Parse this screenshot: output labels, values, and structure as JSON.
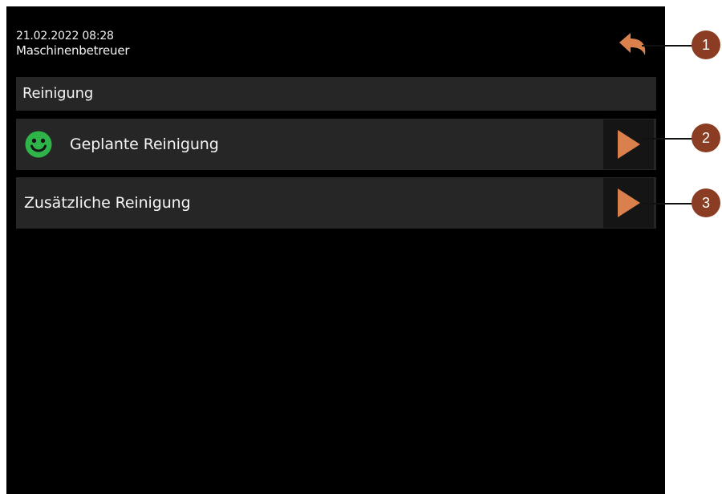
{
  "header": {
    "datetime": "21.02.2022 08:28",
    "user_role": "Maschinenbetreuer",
    "back_icon": "back-arrow-icon"
  },
  "section": {
    "title": "Reinigung"
  },
  "menu": {
    "items": [
      {
        "label": "Geplante Reinigung",
        "status_icon": "smiley-icon",
        "status_color": "#2fb44a",
        "action_icon": "play-arrow-icon"
      },
      {
        "label": "Zusätzliche Reinigung",
        "action_icon": "play-arrow-icon"
      }
    ]
  },
  "callouts": [
    "1",
    "2",
    "3"
  ],
  "colors": {
    "background": "#000000",
    "panel": "#262626",
    "accent": "#d9804d",
    "callout": "#8a3d22"
  }
}
